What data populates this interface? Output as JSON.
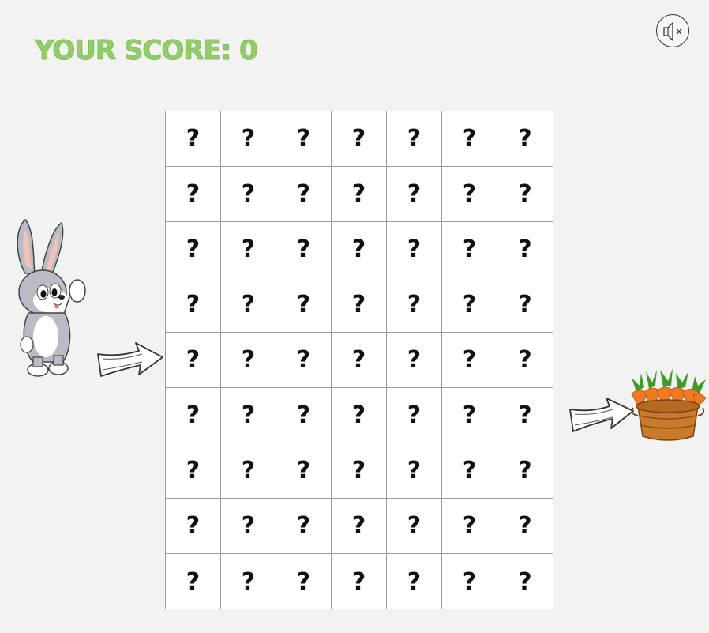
{
  "header": {
    "score_label": "YOUR SCORE: 0"
  },
  "controls": {
    "sound_icon": "speaker-muted-icon"
  },
  "board": {
    "rows": 9,
    "cols": 7,
    "hidden_symbol": "?"
  },
  "characters": {
    "player_icon": "bunny-icon",
    "goal_icon": "carrot-basket-icon",
    "start_arrow_icon": "arrow-right-icon",
    "goal_arrow_icon": "arrow-right-icon"
  },
  "colors": {
    "score": "#93cc6a",
    "background": "#f2f2f2",
    "grid_border": "#9a9a9a"
  }
}
